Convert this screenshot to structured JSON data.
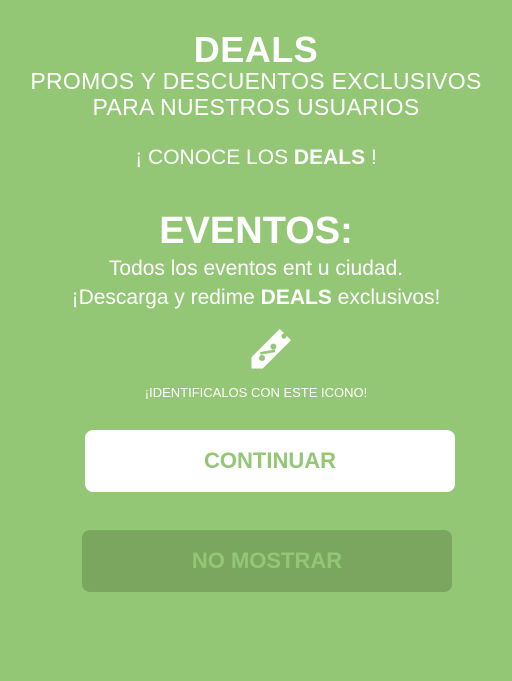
{
  "header": {
    "title": "DEALS",
    "subtitle_line1": "PROMOS Y DESCUENTOS EXCLUSIVOS",
    "subtitle_line2": "PARA NUESTROS USUARIOS"
  },
  "conoce": {
    "prefix": "¡ CONOCE LOS ",
    "highlight": "DEALS",
    "suffix": " !"
  },
  "eventos": {
    "title": "EVENTOS:",
    "line1": "Todos los eventos ent u ciudad.",
    "line2_prefix": "¡Descarga y redime ",
    "line2_highlight": "DEALS",
    "line2_suffix": " exclusivos!"
  },
  "icon": {
    "name": "discount-tag-icon",
    "color": "#ffffff"
  },
  "identify_text": "¡IDENTIFICALOS CON ESTE ICONO!",
  "buttons": {
    "continue_label": "CONTINUAR",
    "no_show_label": "NO MOSTRAR"
  },
  "colors": {
    "background": "#93c675",
    "primary_text": "#ffffff",
    "button_continue_bg": "#ffffff",
    "button_continue_text": "#93c675",
    "button_no_show_bg": "#7aa65f",
    "button_no_show_text": "#93c675"
  }
}
